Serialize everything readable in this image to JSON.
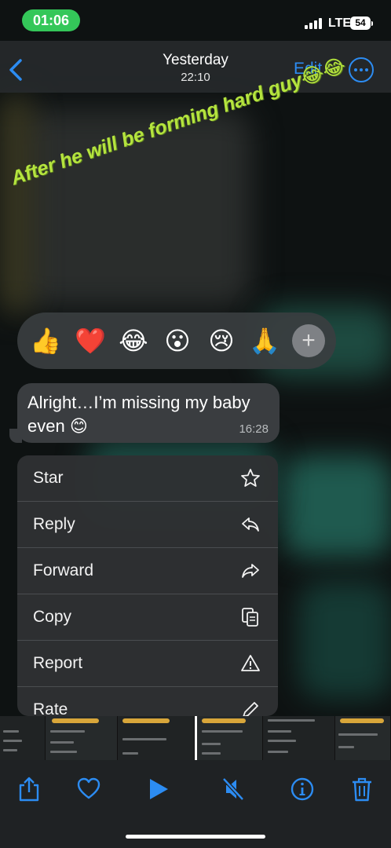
{
  "status_bar": {
    "time": "01:06",
    "network": "LTE",
    "battery": "54",
    "accent": "#34c759"
  },
  "nav": {
    "title": "Yesterday",
    "subtitle": "22:10",
    "edit_label": "Edit",
    "back_icon": "chevron-left-icon",
    "more_icon": "ellipsis-circle-icon",
    "accent": "#2c8cf2"
  },
  "media_caption": "After he will be forming hard guy😂😂",
  "reactions": [
    "👍",
    "❤️",
    "😂",
    "😮",
    "😢",
    "🙏"
  ],
  "reaction_add_label": "+",
  "message": {
    "text": "Alright…I’m missing my baby even 😊",
    "time": "16:28"
  },
  "menu": {
    "items": [
      {
        "label": "Star",
        "icon": "star-icon"
      },
      {
        "label": "Reply",
        "icon": "reply-icon"
      },
      {
        "label": "Forward",
        "icon": "forward-icon"
      },
      {
        "label": "Copy",
        "icon": "copy-icon"
      },
      {
        "label": "Report",
        "icon": "warning-triangle-icon"
      },
      {
        "label": "Rate",
        "icon": "pencil-icon"
      }
    ]
  },
  "toolbar": {
    "icons": [
      "share-icon",
      "heart-icon",
      "play-icon",
      "mute-icon",
      "info-icon",
      "trash-icon"
    ]
  }
}
